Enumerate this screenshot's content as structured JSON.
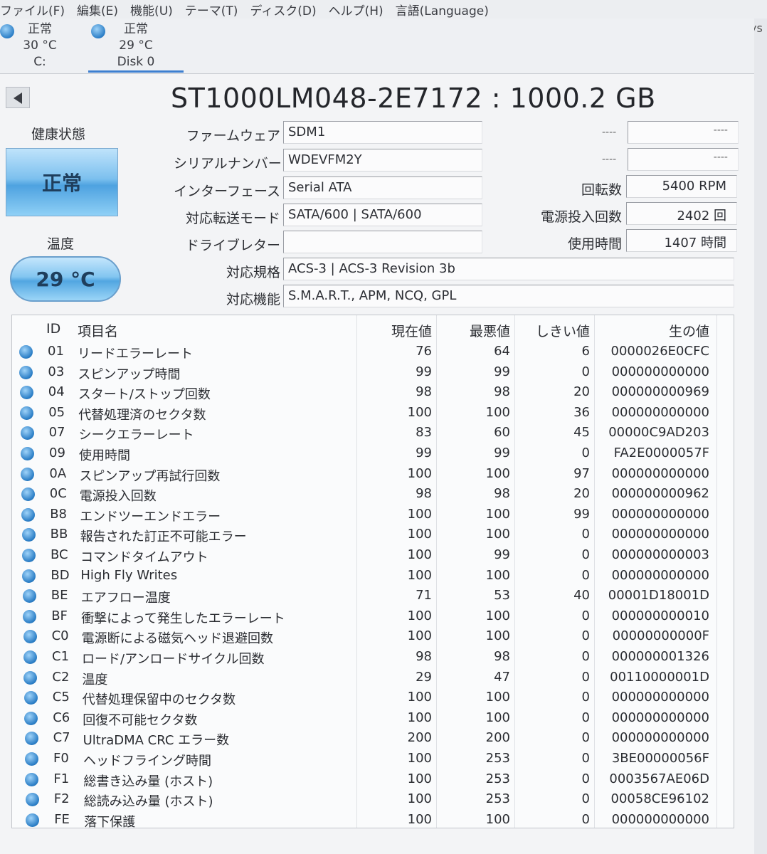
{
  "menu": [
    "ファイル(F)",
    "編集(E)",
    "機能(U)",
    "テーマ(T)",
    "ディスク(D)",
    "ヘルプ(H)",
    "言語(Language)"
  ],
  "right_clip": "ys",
  "disks": [
    {
      "status": "正常",
      "temp": "30 °C",
      "name": "C:"
    },
    {
      "status": "正常",
      "temp": "29 °C",
      "name": "Disk 0"
    }
  ],
  "title": "ST1000LM048-2E7172 : 1000.2 GB",
  "health": {
    "label": "健康状態",
    "status": "正常"
  },
  "temperature": {
    "label": "温度",
    "value": "29 °C"
  },
  "info": {
    "firmware_label": "ファームウェア",
    "firmware": "SDM1",
    "serial_label": "シリアルナンバー",
    "serial": "WDEVFM2Y",
    "interface_label": "インターフェース",
    "interface": "Serial ATA",
    "transfer_label": "対応転送モード",
    "transfer": "SATA/600 | SATA/600",
    "drive_letter_label": "ドライブレター",
    "drive_letter": "",
    "standard_label": "対応規格",
    "standard": "ACS-3 | ACS-3 Revision 3b",
    "features_label": "対応機能",
    "features": "S.M.A.R.T., APM, NCQ, GPL",
    "right1_label": "----",
    "right1_value": "----",
    "right2_label": "----",
    "right2_value": "----",
    "rotation_label": "回転数",
    "rotation": "5400 RPM",
    "power_count_label": "電源投入回数",
    "power_count": "2402 回",
    "hours_label": "使用時間",
    "hours": "1407 時間"
  },
  "smart": {
    "headers": {
      "id": "ID",
      "name": "項目名",
      "current": "現在値",
      "worst": "最悪値",
      "threshold": "しきい値",
      "raw": "生の値"
    },
    "rows": [
      {
        "id": "01",
        "name": "リードエラーレート",
        "current": "76",
        "worst": "64",
        "threshold": "6",
        "raw": "0000026E0CFC"
      },
      {
        "id": "03",
        "name": "スピンアップ時間",
        "current": "99",
        "worst": "99",
        "threshold": "0",
        "raw": "000000000000"
      },
      {
        "id": "04",
        "name": "スタート/ストップ回数",
        "current": "98",
        "worst": "98",
        "threshold": "20",
        "raw": "000000000969"
      },
      {
        "id": "05",
        "name": "代替処理済のセクタ数",
        "current": "100",
        "worst": "100",
        "threshold": "36",
        "raw": "000000000000"
      },
      {
        "id": "07",
        "name": "シークエラーレート",
        "current": "83",
        "worst": "60",
        "threshold": "45",
        "raw": "00000C9AD203"
      },
      {
        "id": "09",
        "name": "使用時間",
        "current": "99",
        "worst": "99",
        "threshold": "0",
        "raw": "FA2E0000057F"
      },
      {
        "id": "0A",
        "name": "スピンアップ再試行回数",
        "current": "100",
        "worst": "100",
        "threshold": "97",
        "raw": "000000000000"
      },
      {
        "id": "0C",
        "name": "電源投入回数",
        "current": "98",
        "worst": "98",
        "threshold": "20",
        "raw": "000000000962"
      },
      {
        "id": "B8",
        "name": "エンドツーエンドエラー",
        "current": "100",
        "worst": "100",
        "threshold": "99",
        "raw": "000000000000"
      },
      {
        "id": "BB",
        "name": "報告された訂正不可能エラー",
        "current": "100",
        "worst": "100",
        "threshold": "0",
        "raw": "000000000000"
      },
      {
        "id": "BC",
        "name": "コマンドタイムアウト",
        "current": "100",
        "worst": "99",
        "threshold": "0",
        "raw": "000000000003"
      },
      {
        "id": "BD",
        "name": "High Fly Writes",
        "current": "100",
        "worst": "100",
        "threshold": "0",
        "raw": "000000000000"
      },
      {
        "id": "BE",
        "name": "エアフロー温度",
        "current": "71",
        "worst": "53",
        "threshold": "40",
        "raw": "00001D18001D"
      },
      {
        "id": "BF",
        "name": "衝撃によって発生したエラーレート",
        "current": "100",
        "worst": "100",
        "threshold": "0",
        "raw": "000000000010"
      },
      {
        "id": "C0",
        "name": "電源断による磁気ヘッド退避回数",
        "current": "100",
        "worst": "100",
        "threshold": "0",
        "raw": "00000000000F"
      },
      {
        "id": "C1",
        "name": "ロード/アンロードサイクル回数",
        "current": "98",
        "worst": "98",
        "threshold": "0",
        "raw": "000000001326"
      },
      {
        "id": "C2",
        "name": "温度",
        "current": "29",
        "worst": "47",
        "threshold": "0",
        "raw": "00110000001D"
      },
      {
        "id": "C5",
        "name": "代替処理保留中のセクタ数",
        "current": "100",
        "worst": "100",
        "threshold": "0",
        "raw": "000000000000"
      },
      {
        "id": "C6",
        "name": "回復不可能セクタ数",
        "current": "100",
        "worst": "100",
        "threshold": "0",
        "raw": "000000000000"
      },
      {
        "id": "C7",
        "name": "UltraDMA CRC エラー数",
        "current": "200",
        "worst": "200",
        "threshold": "0",
        "raw": "000000000000"
      },
      {
        "id": "F0",
        "name": "ヘッドフライング時間",
        "current": "100",
        "worst": "253",
        "threshold": "0",
        "raw": "3BE00000056F"
      },
      {
        "id": "F1",
        "name": "総書き込み量 (ホスト)",
        "current": "100",
        "worst": "253",
        "threshold": "0",
        "raw": "0003567AE06D"
      },
      {
        "id": "F2",
        "name": "総読み込み量 (ホスト)",
        "current": "100",
        "worst": "253",
        "threshold": "0",
        "raw": "00058CE96102"
      },
      {
        "id": "FE",
        "name": "落下保護",
        "current": "100",
        "worst": "100",
        "threshold": "0",
        "raw": "000000000000"
      }
    ]
  }
}
